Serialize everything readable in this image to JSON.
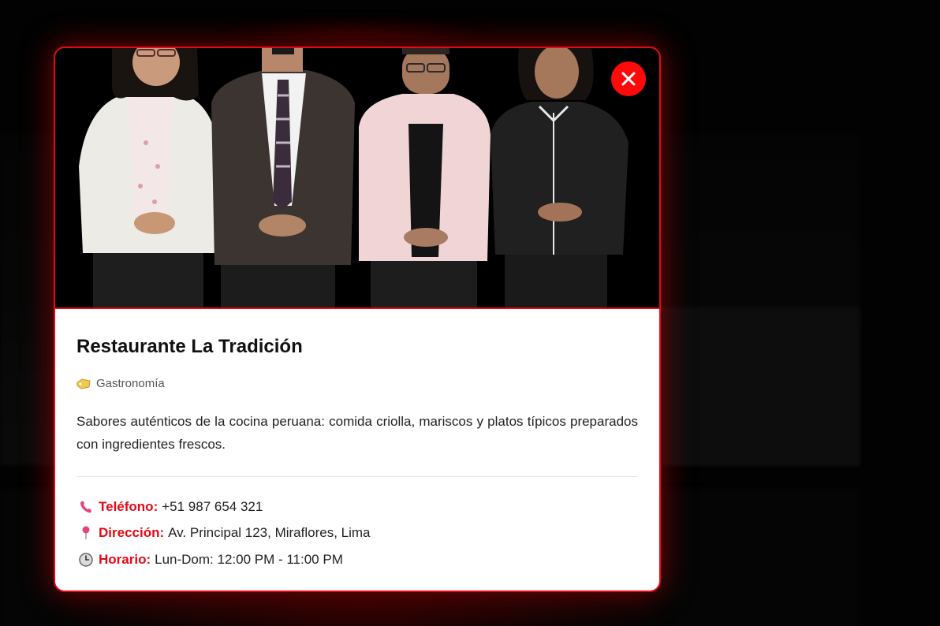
{
  "modal": {
    "title": "Restaurante La Tradición",
    "category": {
      "icon": "tag-icon",
      "label": "Gastronomía"
    },
    "description": "Sabores auténticos de la cocina peruana: comida criolla, mariscos y platos típicos preparados con ingredientes frescos.",
    "close_icon": "close-icon",
    "details": {
      "phone": {
        "icon": "phone-icon",
        "label": "Teléfono:",
        "value": "+51 987 654 321"
      },
      "address": {
        "icon": "pin-icon",
        "label": "Dirección:",
        "value": "Av. Principal 123, Miraflores, Lima"
      },
      "hours": {
        "icon": "clock-icon",
        "label": "Horario:",
        "value": "Lun-Dom: 12:00 PM - 11:00 PM"
      }
    }
  },
  "colors": {
    "accent": "#e50914",
    "close_bg": "#ff0a0a",
    "hero_bg": "#000000"
  }
}
